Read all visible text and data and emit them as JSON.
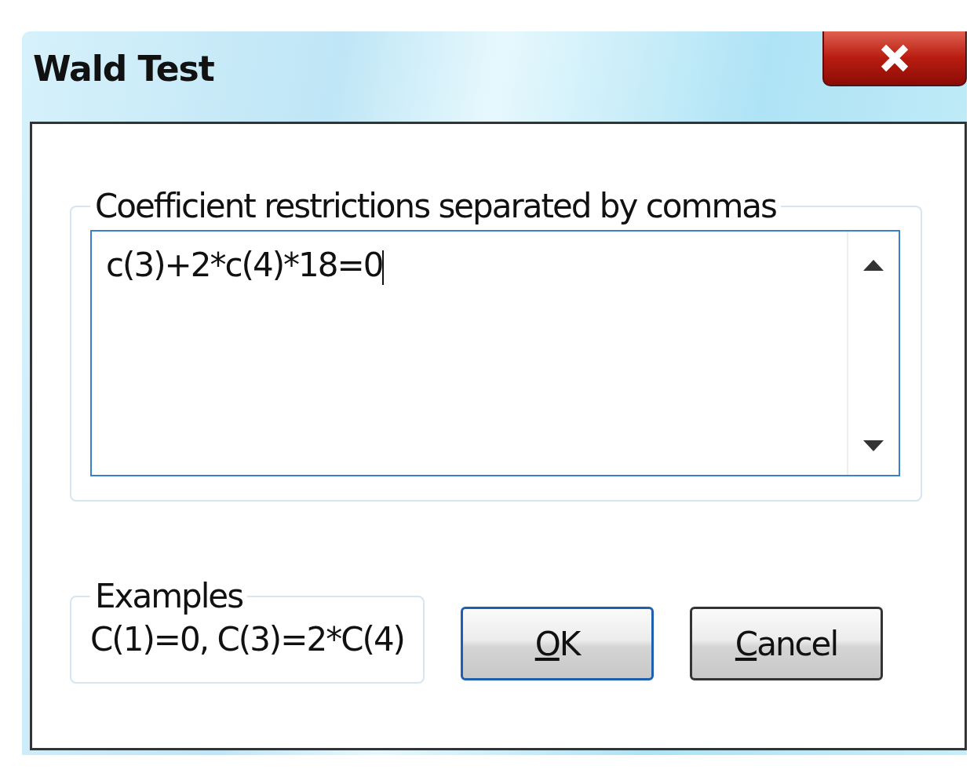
{
  "window": {
    "title": "Wald Test"
  },
  "restrictions": {
    "label": "Coefficient restrictions separated by commas",
    "value": "c(3)+2*c(4)*18=0"
  },
  "examples": {
    "label": "Examples",
    "text": "C(1)=0,  C(3)=2*C(4)"
  },
  "buttons": [
    {
      "label": "OK",
      "default": true
    },
    {
      "label": "Cancel",
      "default": false
    }
  ]
}
